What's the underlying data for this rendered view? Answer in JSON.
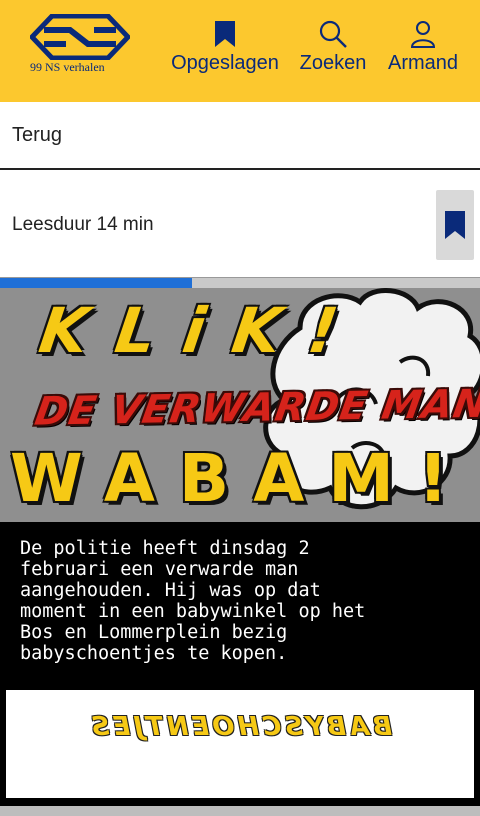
{
  "header": {
    "logo_subtitle": "99 NS verhalen",
    "nav": [
      {
        "label": "Opgeslagen",
        "icon": "bookmark-icon"
      },
      {
        "label": "Zoeken",
        "icon": "search-icon"
      },
      {
        "label": "Armand",
        "icon": "user-icon"
      }
    ]
  },
  "back": {
    "label": "Terug"
  },
  "article": {
    "reading_time": "Leesduur 14 min",
    "save_icon": "bookmark-icon",
    "progress": 0.4
  },
  "comic": {
    "sound_top": "KLiK!",
    "sound_bottom": "WABAM!",
    "title": "DE VERWARDE MAN",
    "caption": "De politie heeft dinsdag 2\nfebruari een verwarde man\naangehouden. Hij was op dat\nmoment in een babywinkel op het\nBos en Lommerplein bezig\nbabyschoentjes te kopen.",
    "panel_text": "BABYSCHOENTJES"
  },
  "colors": {
    "brand_yellow": "#fcc82e",
    "brand_blue": "#0a2a7a",
    "progress": "#1f6fd6",
    "title_red": "#d6231b"
  }
}
